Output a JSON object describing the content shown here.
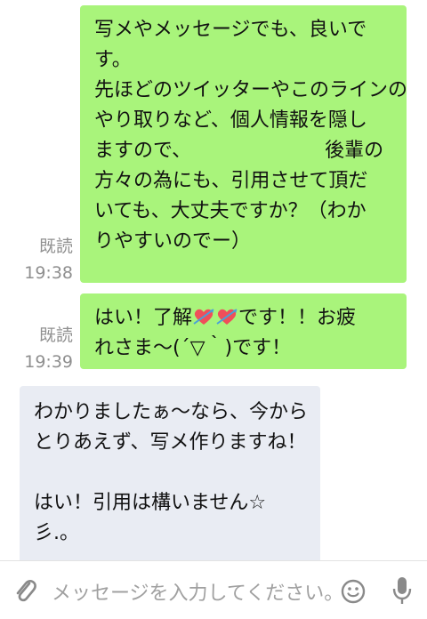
{
  "messages": [
    {
      "lines": [
        "写メやメッセージでも、良いで",
        "す。",
        "先ほどのツイッターやこのラインの",
        "やり取りなど、個人情報を隠し",
        "ますので、",
        "後輩の",
        "方々の為にも、引用させて頂だ",
        "いても、大丈夫ですか？（わか",
        "りやすいのでー）"
      ],
      "read": "既読",
      "time": "19:38"
    },
    {
      "line1_pre": "はい！了解",
      "line1_post": "です！！お疲",
      "line2": "れさま〜(´▽｀)です！",
      "read": "既読",
      "time": "19:39"
    },
    {
      "lines": [
        "わかりましたぁ〜なら、今から",
        "とりあえず、写メ作りますね！",
        "",
        "はい！引用は構いません☆",
        "彡.。"
      ]
    }
  ],
  "input": {
    "placeholder": "メッセージを入力してください。"
  },
  "icons": [
    "paperclip-icon",
    "smiley-icon",
    "microphone-icon",
    "heart-arrow-icon"
  ],
  "colors": {
    "outgoing": "#a9f47b",
    "incoming": "#e9ecf3",
    "meta": "#8f8f8f"
  }
}
